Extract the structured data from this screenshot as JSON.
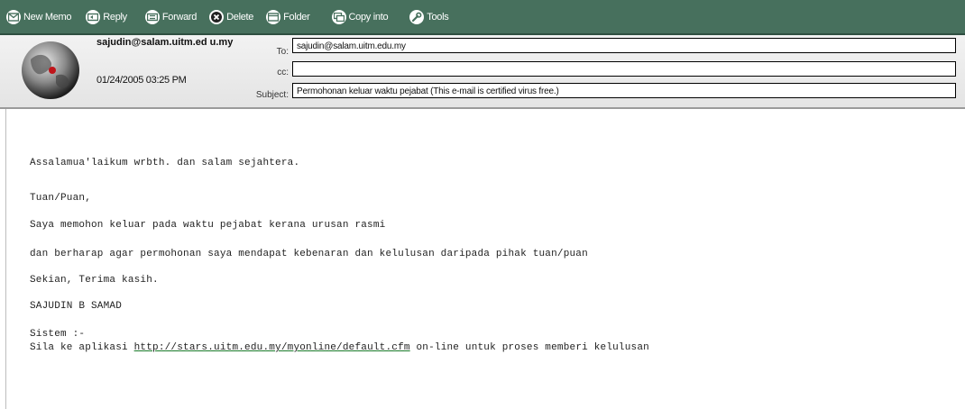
{
  "toolbar": {
    "items": [
      {
        "label": "New Memo",
        "icon": "envelope-icon"
      },
      {
        "label": "Reply",
        "icon": "reply-icon"
      },
      {
        "label": "Forward",
        "icon": "forward-icon"
      },
      {
        "label": "Delete",
        "icon": "delete-icon"
      },
      {
        "label": "Folder",
        "icon": "folder-icon"
      },
      {
        "label": "Copy into",
        "icon": "copy-icon"
      },
      {
        "label": "Tools",
        "icon": "wrench-icon"
      }
    ]
  },
  "header": {
    "sender": "sajudin@salam.uitm.ed u.my",
    "date": "01/24/2005 03:25 PM",
    "to_label": "To:",
    "to_value": "sajudin@salam.uitm.edu.my",
    "cc_label": "cc:",
    "cc_value": "",
    "subject_label": "Subject:",
    "subject_value": "Permohonan keluar waktu pejabat  (This e-mail is certified virus free.)"
  },
  "body": {
    "greeting": "Assalamua'laikum wrbth. dan salam sejahtera.",
    "salutation": "Tuan/Puan,",
    "line1": "Saya memohon keluar pada waktu pejabat kerana urusan rasmi",
    "line2": "dan berharap agar permohonan saya mendapat kebenaran dan kelulusan daripada pihak tuan/puan",
    "closing": "Sekian, Terima kasih.",
    "signature": "SAJUDIN B SAMAD",
    "system_label": "Sistem :-",
    "system_prefix": "Sila ke aplikasi ",
    "system_link": "http://stars.uitm.edu.my/myonline/default.cfm",
    "system_suffix": " on-line untuk proses memberi kelulusan"
  },
  "colors": {
    "toolbar": "#47705d",
    "link_underline": "#1a7a2a"
  }
}
